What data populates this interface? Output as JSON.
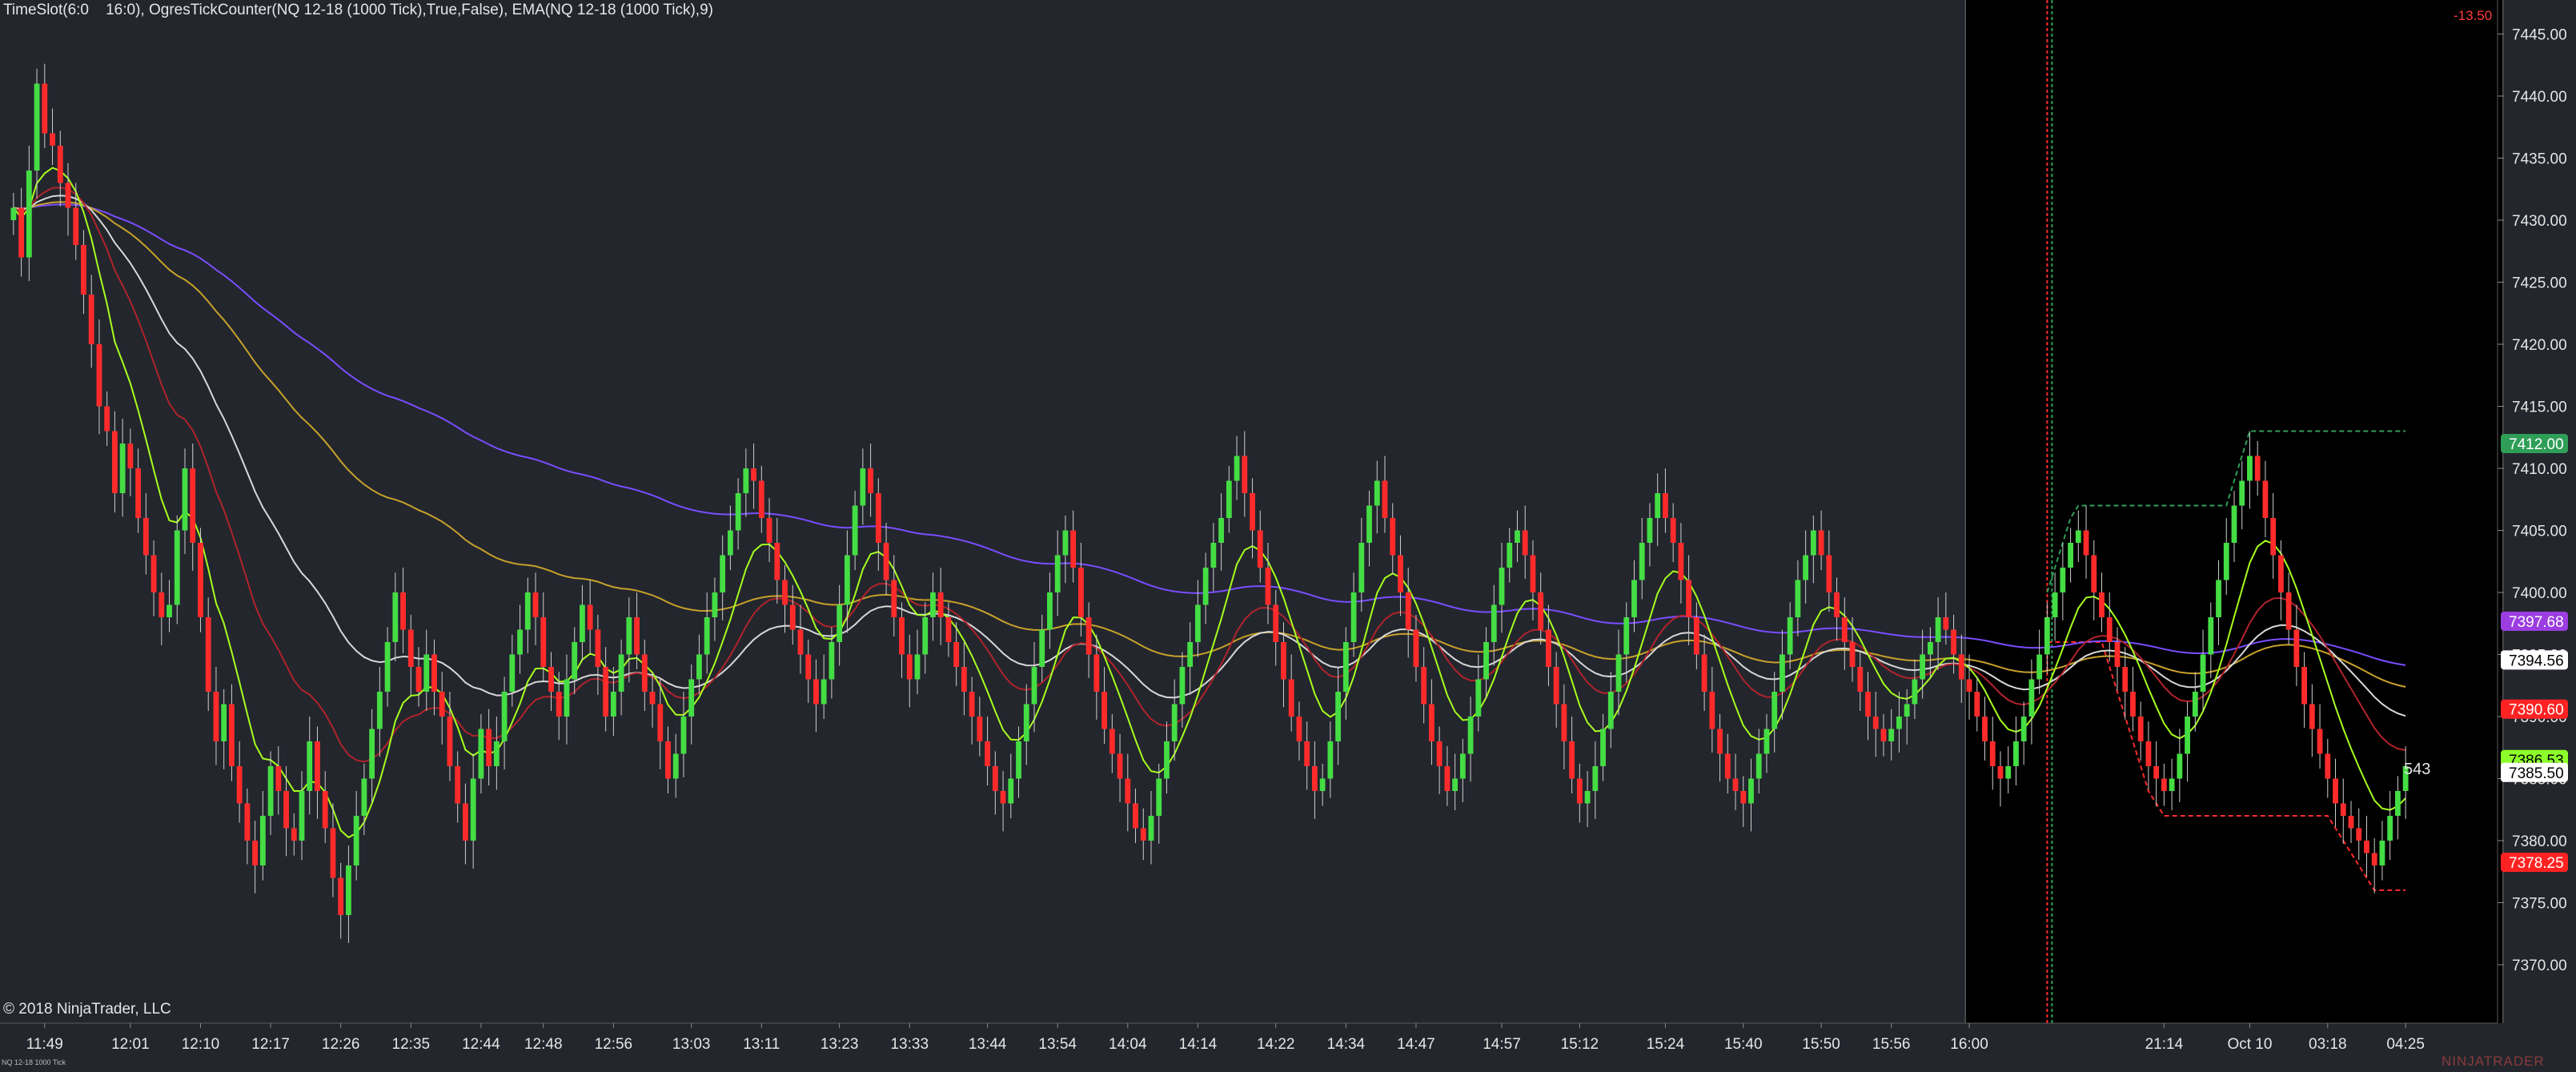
{
  "header": {
    "indicator_label": "TimeSlot(6:0    16:0), OgresTickCounter(NQ 12-18 (1000 Tick),True,False), EMA(NQ 12-18 (1000 Tick),9)",
    "pnl_text": "-13.50",
    "tick_counter": "543"
  },
  "footer": {
    "copyright": "© 2018 NinjaTrader, LLC",
    "instrument": "NQ 12-18 1000 Tick",
    "brand": "NINJATRADER"
  },
  "colors": {
    "background": "#23262d",
    "session_shade": "#000000",
    "up_candle": "#44dd44",
    "down_candle": "#ff2b2b",
    "ema_fast": "#a6ff1e",
    "ema_mid": "#b0232b",
    "ema_slow": "#d8d8d8",
    "sma_long": "#c7a12a",
    "sma_purple": "#7a4dff"
  },
  "chart_data": {
    "type": "candlestick",
    "instrument": "NQ 12-18 (1000 Tick)",
    "ylim": [
      7365,
      7445
    ],
    "y_ticks": [
      7370,
      7375,
      7380,
      7385,
      7390,
      7395,
      7400,
      7405,
      7410,
      7415,
      7420,
      7425,
      7430,
      7435,
      7440,
      7445
    ],
    "x_tick_labels": [
      "11:49",
      "12:01",
      "12:10",
      "12:17",
      "12:26",
      "12:35",
      "12:44",
      "12:48",
      "12:56",
      "13:03",
      "13:11",
      "13:23",
      "13:33",
      "13:44",
      "13:54",
      "14:04",
      "14:14",
      "14:22",
      "14:34",
      "14:47",
      "14:57",
      "15:12",
      "15:24",
      "15:40",
      "15:50",
      "15:56",
      "16:00",
      "21:14",
      "Oct 10",
      "03:18",
      "04:25"
    ],
    "x_tick_bar_index": [
      4,
      15,
      24,
      33,
      42,
      51,
      60,
      68,
      77,
      87,
      96,
      106,
      115,
      125,
      134,
      143,
      152,
      162,
      171,
      180,
      191,
      201,
      212,
      222,
      232,
      241,
      251,
      276,
      287,
      297,
      307
    ],
    "session_start_bar": 251,
    "session_end_bar": 319,
    "closes": [
      7431,
      7427,
      7434,
      7441,
      7437,
      7436,
      7433,
      7431,
      7428,
      7424,
      7420,
      7415,
      7413,
      7408,
      7412,
      7410,
      7406,
      7403,
      7400,
      7398,
      7399,
      7405,
      7410,
      7404,
      7398,
      7392,
      7388,
      7391,
      7386,
      7383,
      7380,
      7378,
      7382,
      7386,
      7384,
      7381,
      7380,
      7384,
      7388,
      7384,
      7381,
      7377,
      7374,
      7378,
      7382,
      7385,
      7389,
      7392,
      7396,
      7400,
      7397,
      7394,
      7392,
      7395,
      7392,
      7390,
      7386,
      7383,
      7380,
      7385,
      7389,
      7386,
      7388,
      7392,
      7395,
      7397,
      7400,
      7398,
      7394,
      7392,
      7390,
      7393,
      7396,
      7399,
      7397,
      7394,
      7390,
      7392,
      7395,
      7398,
      7395,
      7392,
      7391,
      7388,
      7385,
      7387,
      7390,
      7393,
      7395,
      7398,
      7400,
      7403,
      7405,
      7408,
      7410,
      7409,
      7406,
      7404,
      7401,
      7399,
      7397,
      7395,
      7393,
      7391,
      7393,
      7396,
      7399,
      7403,
      7407,
      7410,
      7408,
      7404,
      7401,
      7398,
      7395,
      7393,
      7395,
      7398,
      7400,
      7398,
      7396,
      7394,
      7392,
      7390,
      7388,
      7386,
      7384,
      7383,
      7385,
      7388,
      7391,
      7394,
      7397,
      7400,
      7403,
      7405,
      7402,
      7398,
      7395,
      7392,
      7389,
      7387,
      7385,
      7383,
      7381,
      7380,
      7382,
      7385,
      7388,
      7391,
      7394,
      7396,
      7399,
      7402,
      7404,
      7406,
      7409,
      7411,
      7408,
      7405,
      7402,
      7399,
      7396,
      7393,
      7390,
      7388,
      7386,
      7384,
      7385,
      7388,
      7392,
      7396,
      7400,
      7404,
      7407,
      7409,
      7406,
      7403,
      7400,
      7397,
      7394,
      7391,
      7388,
      7386,
      7384,
      7385,
      7387,
      7390,
      7393,
      7396,
      7399,
      7402,
      7404,
      7405,
      7403,
      7400,
      7397,
      7394,
      7391,
      7388,
      7385,
      7383,
      7384,
      7386,
      7389,
      7392,
      7395,
      7398,
      7401,
      7404,
      7406,
      7408,
      7406,
      7404,
      7401,
      7398,
      7395,
      7392,
      7389,
      7387,
      7385,
      7384,
      7383,
      7385,
      7387,
      7389,
      7392,
      7395,
      7398,
      7401,
      7403,
      7405,
      7403,
      7400,
      7398,
      7396,
      7394,
      7392,
      7390,
      7389,
      7388,
      7389,
      7390,
      7391,
      7393,
      7395,
      7396,
      7398,
      7397,
      7395,
      7393,
      7392,
      7390,
      7388,
      7386,
      7385,
      7386,
      7388,
      7390,
      7393,
      7395,
      7398,
      7400,
      7402,
      7404,
      7405,
      7403,
      7400,
      7398,
      7396,
      7394,
      7392,
      7390,
      7388,
      7386,
      7385,
      7384,
      7385,
      7387,
      7390,
      7392,
      7395,
      7398,
      7401,
      7404,
      7407,
      7409,
      7411,
      7409,
      7406,
      7403,
      7400,
      7397,
      7394,
      7391,
      7389,
      7387,
      7385,
      7383,
      7382,
      7381,
      7380,
      7379,
      7378,
      7380,
      7382,
      7384,
      7386
    ],
    "price_markers": [
      {
        "label": "7412.00",
        "value": 7412.0,
        "color": "#2f9e57",
        "text_color": "#ffffff"
      },
      {
        "label": "7397.68",
        "value": 7397.68,
        "color": "#9b3de0",
        "text_color": "#ffffff"
      },
      {
        "label": "7394.56",
        "value": 7394.56,
        "color": "#ffffff",
        "text_color": "#000000"
      },
      {
        "label": "7390.60",
        "value": 7390.6,
        "color": "#ff2222",
        "text_color": "#ffffff"
      },
      {
        "label": "7386.53",
        "value": 7386.53,
        "color": "#8dff2a",
        "text_color": "#000000"
      },
      {
        "label": "7385.50",
        "value": 7385.5,
        "color": "#ffffff",
        "text_color": "#000000"
      },
      {
        "label": "7378.25",
        "value": 7378.25,
        "color": "#ff2222",
        "text_color": "#ffffff"
      }
    ]
  }
}
